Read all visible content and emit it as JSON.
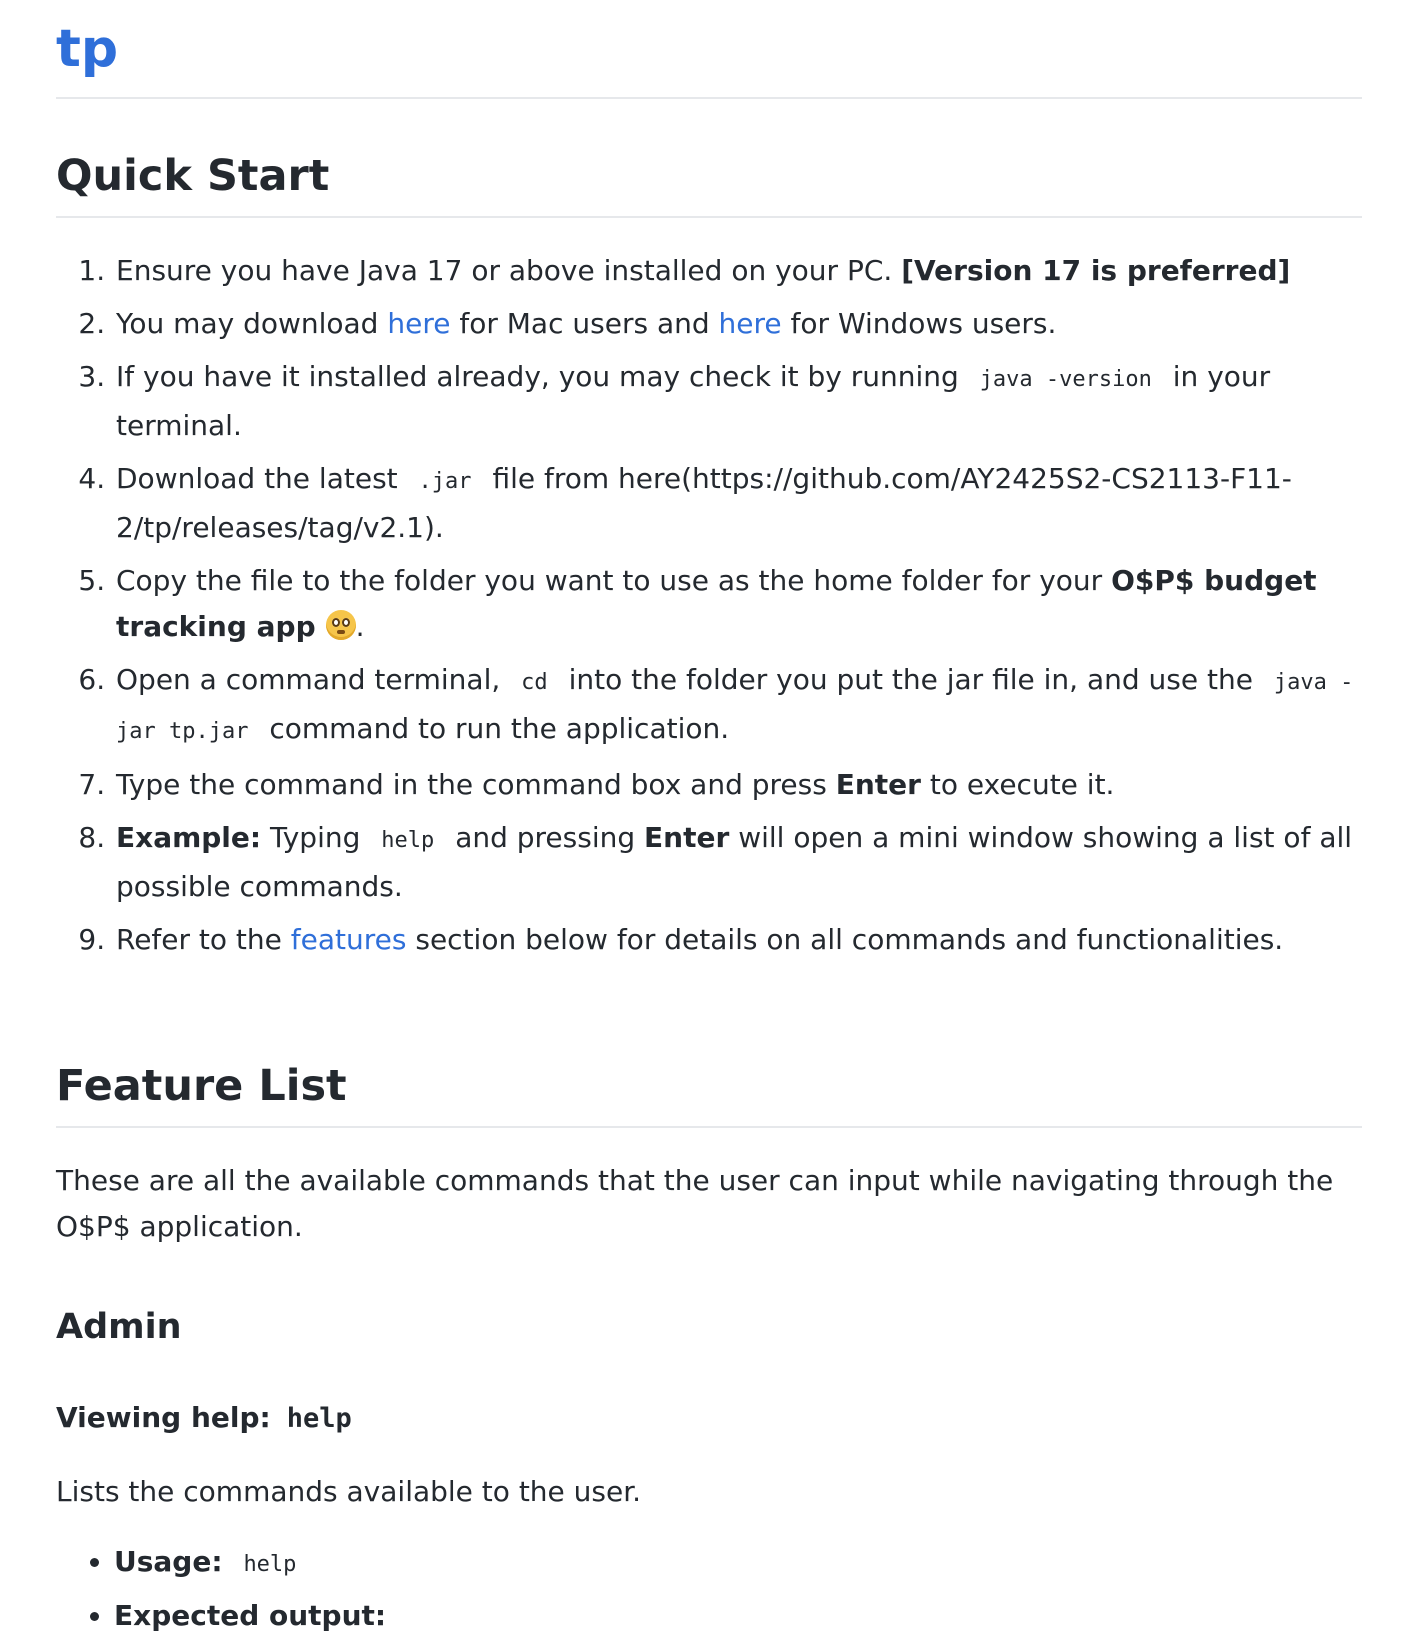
{
  "site": {
    "title": "tp"
  },
  "quick_start": {
    "heading": "Quick Start",
    "steps": [
      {
        "text": "Ensure you have Java 17 or above installed on your PC. ",
        "bold": "[Version 17 is preferred]"
      },
      {
        "before": "You may download ",
        "link1": "here",
        "middle": " for Mac users and ",
        "link2": "here",
        "after": " for Windows users."
      },
      {
        "before": "If you have it installed already, you may check it by running",
        "code": "java -version",
        "after": "in your terminal."
      },
      {
        "before": "Download the latest",
        "code": ".jar",
        "after": "file from here(https://github.com/AY2425S2-CS2113-F11-2/tp/releases/tag/v2.1)."
      },
      {
        "before": "Copy the file to the folder you want to use as the home folder for your ",
        "bold": "O$P$ budget tracking app",
        "after": "."
      },
      {
        "before": "Open a command terminal,",
        "code1": "cd",
        "middle": "into the folder you put the jar file in, and use the",
        "code2": "java -jar tp.jar",
        "after": "command to run the application."
      },
      {
        "before": "Type the command in the command box and press ",
        "bold": "Enter",
        "after": " to execute it."
      },
      {
        "bold1": "Example:",
        "before": " Typing",
        "code": "help",
        "middle": "and pressing ",
        "bold2": "Enter",
        "after": " will open a mini window showing a list of all possible commands."
      },
      {
        "before": "Refer to the ",
        "link": "features",
        "after": " section below for details on all commands and functionalities."
      }
    ]
  },
  "feature_list": {
    "heading": "Feature List",
    "intro": "These are all the available commands that the user can input while navigating through the O$P$ application.",
    "admin": {
      "heading": "Admin",
      "help": {
        "title_label": "Viewing help:",
        "title_code": "help",
        "description": "Lists the commands available to the user.",
        "usage_label": "Usage:",
        "usage_code": "help",
        "output_label": "Expected output:"
      }
    }
  }
}
